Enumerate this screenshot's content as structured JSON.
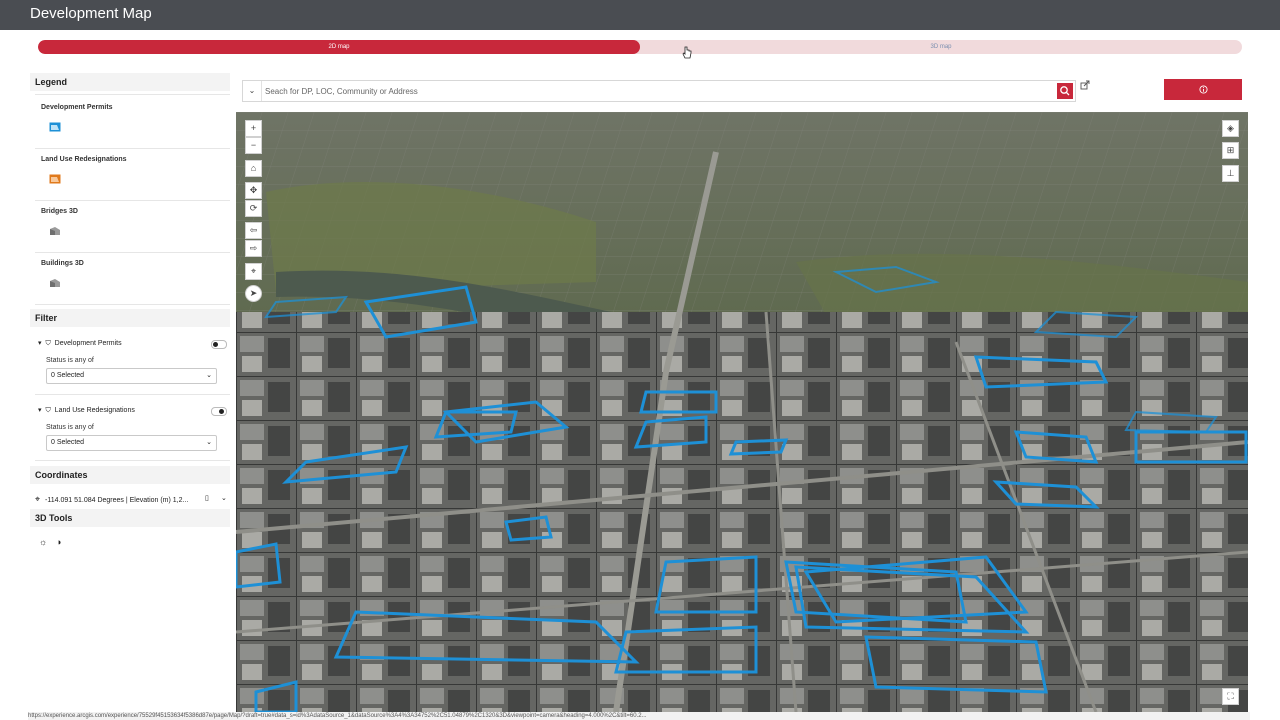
{
  "app": {
    "title": "Development Map"
  },
  "view_toggle": {
    "left_label": "2D map",
    "right_label": "3D map",
    "selected": "2D map"
  },
  "search": {
    "placeholder": "Seach for DP, LOC, Community or Address"
  },
  "info_button": {
    "icon": "info-circle-icon"
  },
  "legend": {
    "header": "Legend",
    "items": [
      {
        "label": "Development Permits",
        "color": "#1e90d6"
      },
      {
        "label": "Land Use Redesignations",
        "color": "#e07a1c"
      },
      {
        "label": "Bridges 3D",
        "color": "#8a8a8a"
      },
      {
        "label": "Buildings 3D",
        "color": "#8a8a8a"
      }
    ]
  },
  "filter": {
    "header": "Filter",
    "groups": [
      {
        "title": "Development Permits",
        "sub": "Status is any of",
        "selected": "0 Selected"
      },
      {
        "title": "Land Use Redesignations",
        "sub": "Status is any of",
        "selected": "0 Selected"
      }
    ]
  },
  "coordinates": {
    "header": "Coordinates",
    "value": "-114.091 51.084 Degrees | Elevation (m) 1,2..."
  },
  "tools_3d": {
    "header": "3D Tools"
  },
  "map_controls": {
    "zoom_in": "+",
    "zoom_out": "−"
  },
  "status": {
    "url": "https://experience.arcgis.com/experience/75529f45153634f5386d87e/page/Map/?draft=true#data_s=id%3AdataSource_1&dataSource%3A4%3A34752%2C51.04879%2C1320&3D&viewpoint=camera&heading=4.000%2C&tilt=60.2..."
  },
  "colors": {
    "accent": "#c8283b",
    "accent_light": "#f1dadc",
    "titlebar": "#4a4d52",
    "parcel_outline": "#1e90d6"
  }
}
